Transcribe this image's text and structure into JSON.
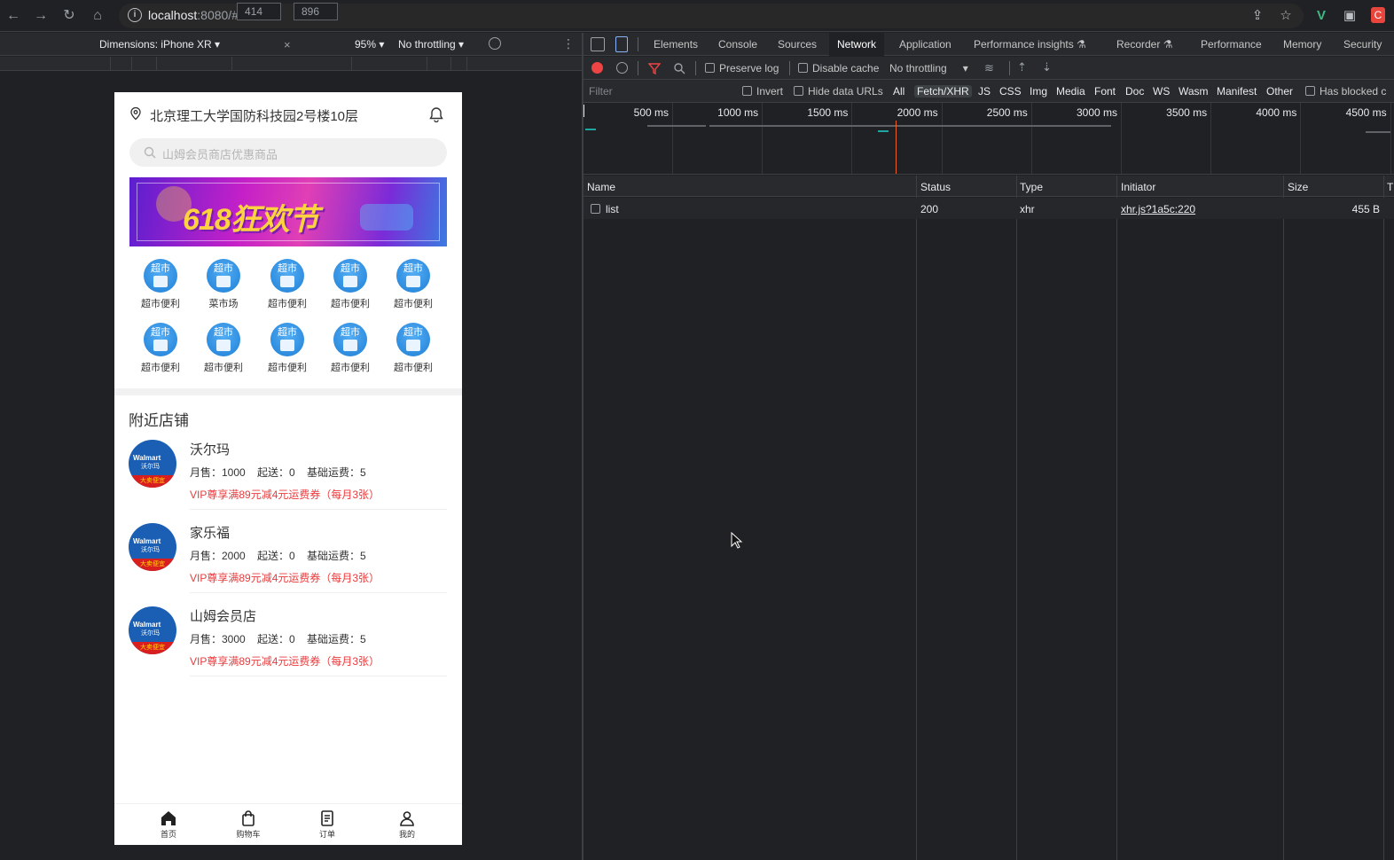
{
  "browser": {
    "url_host": "localhost",
    "url_rest": ":8080/#/"
  },
  "device_toolbar": {
    "dimensions_label": "Dimensions: iPhone XR ▾",
    "width": "414",
    "height": "896",
    "x": "×",
    "zoom": "95% ▾",
    "throttling": "No throttling ▾"
  },
  "app": {
    "location": "北京理工大学国防科技园2号楼10层",
    "search_placeholder": "山姆会员商店优惠商品",
    "banner_text": "618狂欢节",
    "category_icon_text": "超市",
    "categories": [
      "超市便利",
      "菜市场",
      "超市便利",
      "超市便利",
      "超市便利",
      "超市便利",
      "超市便利",
      "超市便利",
      "超市便利",
      "超市便利"
    ],
    "nearby_title": "附近店铺",
    "logo_text": "Walmart",
    "logo_text2": "沃尔玛",
    "logo_band": "大卖便宜",
    "shops": [
      {
        "name": "沃尔玛",
        "meta": "月售：1000    起送：0    基础运费：5",
        "promo": "VIP尊享满89元减4元运费券（每月3张）"
      },
      {
        "name": "家乐福",
        "meta": "月售：2000    起送：0    基础运费：5",
        "promo": "VIP尊享满89元减4元运费券（每月3张）"
      },
      {
        "name": "山姆会员店",
        "meta": "月售：3000    起送：0    基础运费：5",
        "promo": "VIP尊享满89元减4元运费券（每月3张）"
      }
    ],
    "tabs": [
      "首页",
      "购物车",
      "订单",
      "我的"
    ]
  },
  "devtools": {
    "tabs": [
      "Elements",
      "Console",
      "Sources",
      "Network",
      "Application",
      "Performance insights ⚗",
      "Recorder ⚗",
      "Performance",
      "Memory",
      "Security"
    ],
    "toolbar": {
      "preserve_log": "Preserve log",
      "disable_cache": "Disable cache",
      "throttling": "No throttling"
    },
    "filter": {
      "placeholder": "Filter",
      "invert": "Invert",
      "hide_data_urls": "Hide data URLs",
      "types": [
        "All",
        "Fetch/XHR",
        "JS",
        "CSS",
        "Img",
        "Media",
        "Font",
        "Doc",
        "WS",
        "Wasm",
        "Manifest",
        "Other"
      ],
      "selected_type": "Fetch/XHR",
      "has_blocked": "Has blocked c"
    },
    "timeline_labels": [
      "500 ms",
      "1000 ms",
      "1500 ms",
      "2000 ms",
      "2500 ms",
      "3000 ms",
      "3500 ms",
      "4000 ms",
      "4500 ms"
    ],
    "columns": [
      "Name",
      "Status",
      "Type",
      "Initiator",
      "Size",
      "T"
    ],
    "rows": [
      {
        "name": "list",
        "status": "200",
        "type": "xhr",
        "initiator": "xhr.js?1a5c:220",
        "size": "455 B"
      }
    ]
  },
  "colors": {
    "accent_red": "#e93b3d",
    "icon_blue": "#1f7fd6",
    "devtools_bg": "#202124"
  }
}
